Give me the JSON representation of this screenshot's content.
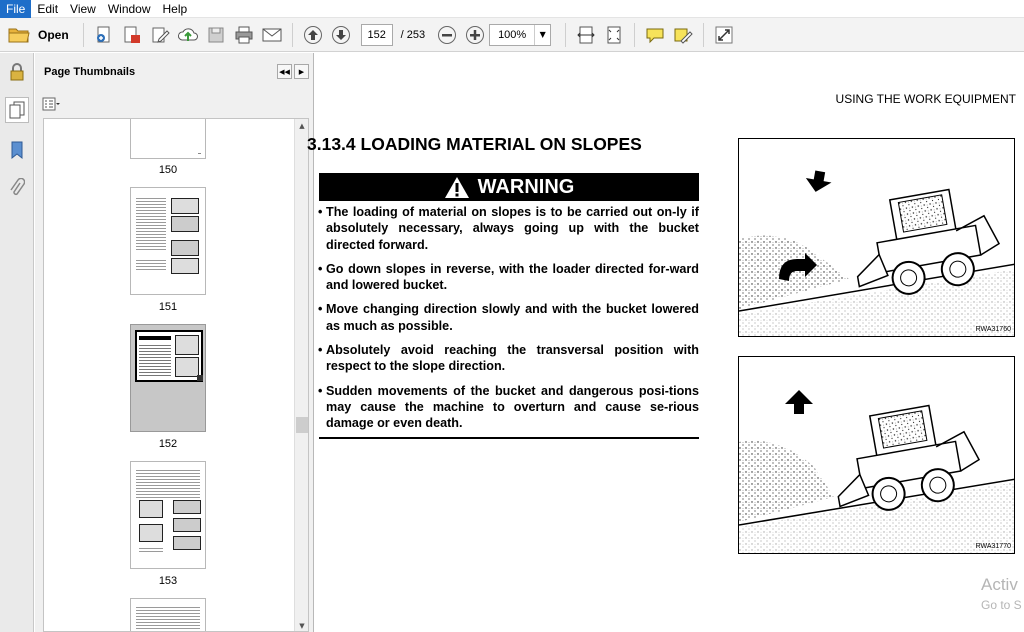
{
  "menubar": {
    "items": [
      "File",
      "Edit",
      "View",
      "Window",
      "Help"
    ]
  },
  "toolbar": {
    "open_label": "Open",
    "current_page": "152",
    "page_total": "/ 253",
    "zoom": "100%"
  },
  "sidebar": {
    "title": "Page Thumbnails",
    "thumbnails": [
      {
        "label": "150"
      },
      {
        "label": "151"
      },
      {
        "label": "152",
        "selected": true
      },
      {
        "label": "153"
      }
    ]
  },
  "document": {
    "running_head": "USING THE WORK EQUIPMENT",
    "section_title": "3.13.4 LOADING MATERIAL ON SLOPES",
    "warning_label": "WARNING",
    "warnings": [
      "The loading of material on slopes is to be carried out on-ly if absolutely necessary, always going up with the bucket directed forward.",
      "Go down slopes in reverse, with the loader directed for-ward and lowered bucket.",
      "Move changing direction slowly and with the bucket lowered as much as possible.",
      "Absolutely avoid reaching the transversal position with respect to the slope direction.",
      "Sudden movements of the bucket and dangerous posi-tions may cause the machine to overturn and cause se-rious damage or even death."
    ],
    "figures": [
      {
        "code": "RWA31760"
      },
      {
        "code": "RWA31770"
      }
    ]
  },
  "watermark": {
    "line1": "Activ",
    "line2": "Go to S"
  },
  "colors": {
    "menu_highlight": "#1e6ec9",
    "toolbar_bg": "#f3f3f3",
    "panel_bg": "#f0f0f0"
  }
}
